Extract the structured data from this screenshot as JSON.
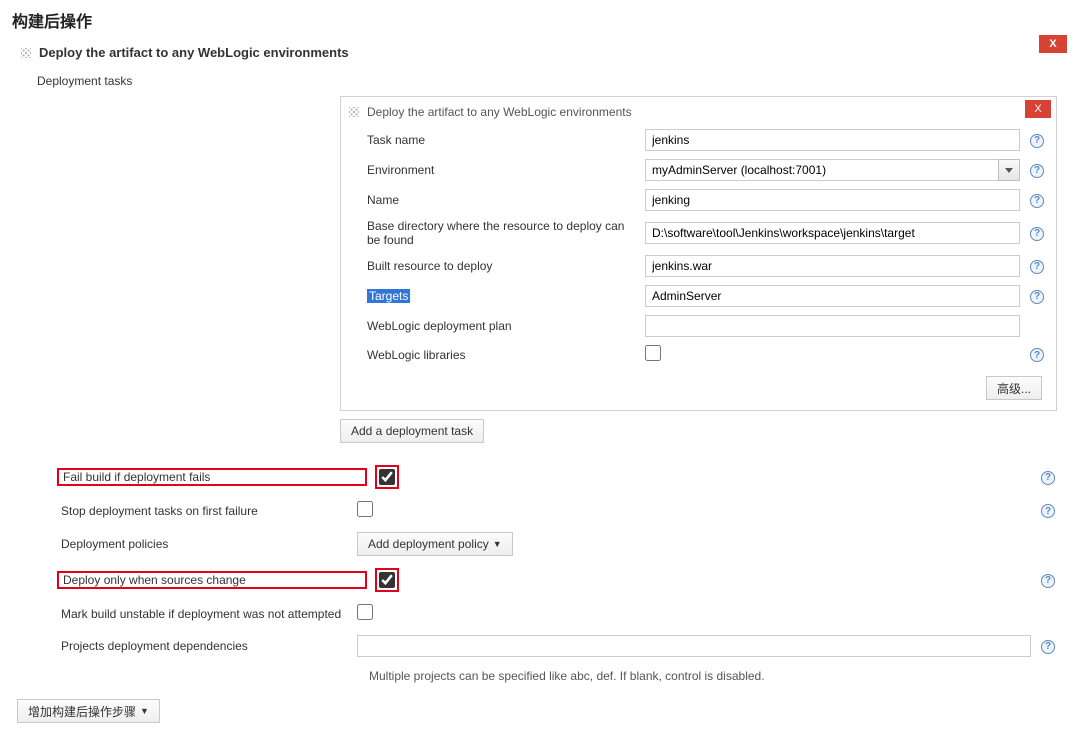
{
  "page": {
    "title": "构建后操作"
  },
  "section": {
    "title": "Deploy the artifact to any WebLogic environments",
    "close": "X"
  },
  "tasks": {
    "label": "Deployment tasks"
  },
  "task": {
    "header": "Deploy the artifact to any WebLogic environments",
    "close": "X",
    "fields": {
      "task_name": {
        "label": "Task name",
        "value": "jenkins"
      },
      "environment": {
        "label": "Environment",
        "value": "myAdminServer (localhost:7001)"
      },
      "name": {
        "label": "Name",
        "value": "jenking"
      },
      "base_dir": {
        "label": "Base directory where the resource to deploy can be found",
        "value": "D:\\software\\tool\\Jenkins\\workspace\\jenkins\\target"
      },
      "built_res": {
        "label": "Built resource to deploy",
        "value": "jenkins.war"
      },
      "targets": {
        "label": "Targets",
        "value": "AdminServer"
      },
      "plan": {
        "label": "WebLogic deployment plan",
        "value": ""
      },
      "libs": {
        "label": "WebLogic libraries",
        "checked": false
      }
    },
    "advanced_btn": "高级...",
    "add_btn": "Add a deployment task"
  },
  "options": {
    "fail_build": {
      "label": "Fail build if deployment fails",
      "checked": true
    },
    "stop_first": {
      "label": "Stop deployment tasks on first failure",
      "checked": false
    },
    "policies": {
      "label": "Deployment policies",
      "btn": "Add deployment policy"
    },
    "only_changes": {
      "label": "Deploy only when sources change",
      "checked": true
    },
    "mark_unstable": {
      "label": "Mark build unstable if deployment was not attempted",
      "checked": false
    },
    "dependencies": {
      "label": "Projects deployment dependencies",
      "value": ""
    },
    "dependencies_hint": "Multiple projects can be specified like abc, def. If blank, control is disabled."
  },
  "footer": {
    "add_step_btn": "增加构建后操作步骤"
  }
}
